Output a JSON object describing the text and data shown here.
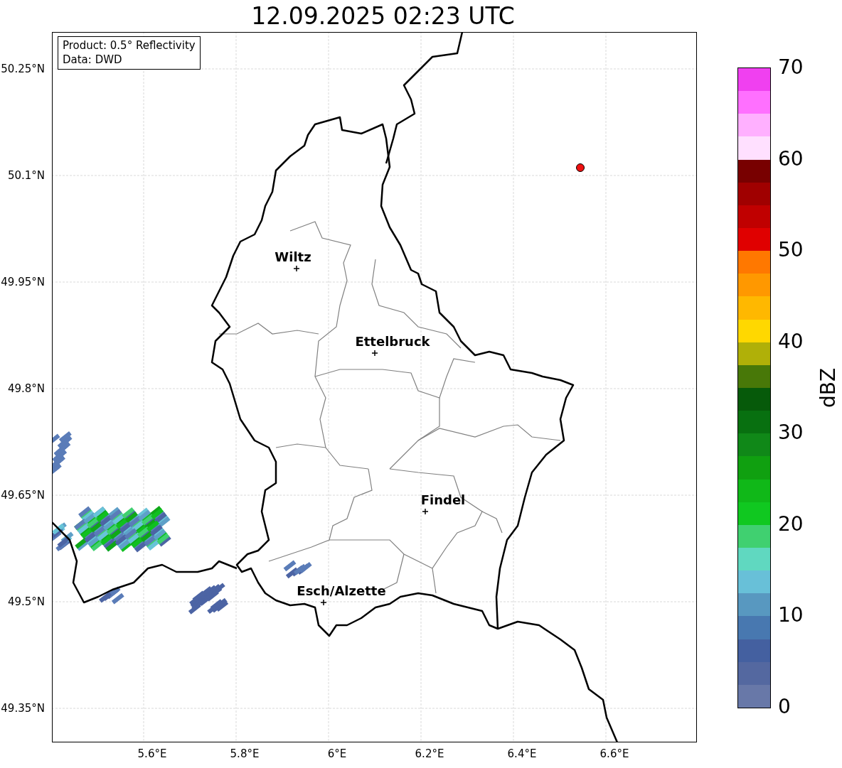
{
  "title": "12.09.2025 02:23 UTC",
  "info_box": [
    "Product: 0.5° Reflectivity",
    "Data: DWD"
  ],
  "y_ticks": [
    "50.25°N",
    "50.1°N",
    "49.95°N",
    "49.8°N",
    "49.65°N",
    "49.5°N",
    "49.35°N"
  ],
  "x_ticks": [
    "5.6°E",
    "5.8°E",
    "6°E",
    "6.2°E",
    "6.4°E",
    "6.6°E"
  ],
  "cities": [
    {
      "name": "Wiltz"
    },
    {
      "name": "Ettelbruck"
    },
    {
      "name": "Findel"
    },
    {
      "name": "Esch/Alzette"
    }
  ],
  "colorbar": {
    "label": "dBZ",
    "ticks": [
      "70",
      "60",
      "50",
      "40",
      "30",
      "20",
      "10",
      "0"
    ],
    "segments": [
      {
        "color": "#f040f0"
      },
      {
        "color": "#ff70ff"
      },
      {
        "color": "#ffb0ff"
      },
      {
        "color": "#ffe0ff"
      },
      {
        "color": "#780000"
      },
      {
        "color": "#a00000"
      },
      {
        "color": "#c00000"
      },
      {
        "color": "#e00000"
      },
      {
        "color": "#ff7800"
      },
      {
        "color": "#ff9800"
      },
      {
        "color": "#ffb800"
      },
      {
        "color": "#ffd800"
      },
      {
        "color": "#b0b008"
      },
      {
        "color": "#487808"
      },
      {
        "color": "#065a0a"
      },
      {
        "color": "#087010"
      },
      {
        "color": "#108818"
      },
      {
        "color": "#10a010"
      },
      {
        "color": "#10b818"
      },
      {
        "color": "#10c820"
      },
      {
        "color": "#40d070"
      },
      {
        "color": "#60d8c0"
      },
      {
        "color": "#68c0d8"
      },
      {
        "color": "#5898c0"
      },
      {
        "color": "#4878b0"
      },
      {
        "color": "#4460a0"
      },
      {
        "color": "#5468a0"
      },
      {
        "color": "#6878a8"
      }
    ]
  }
}
